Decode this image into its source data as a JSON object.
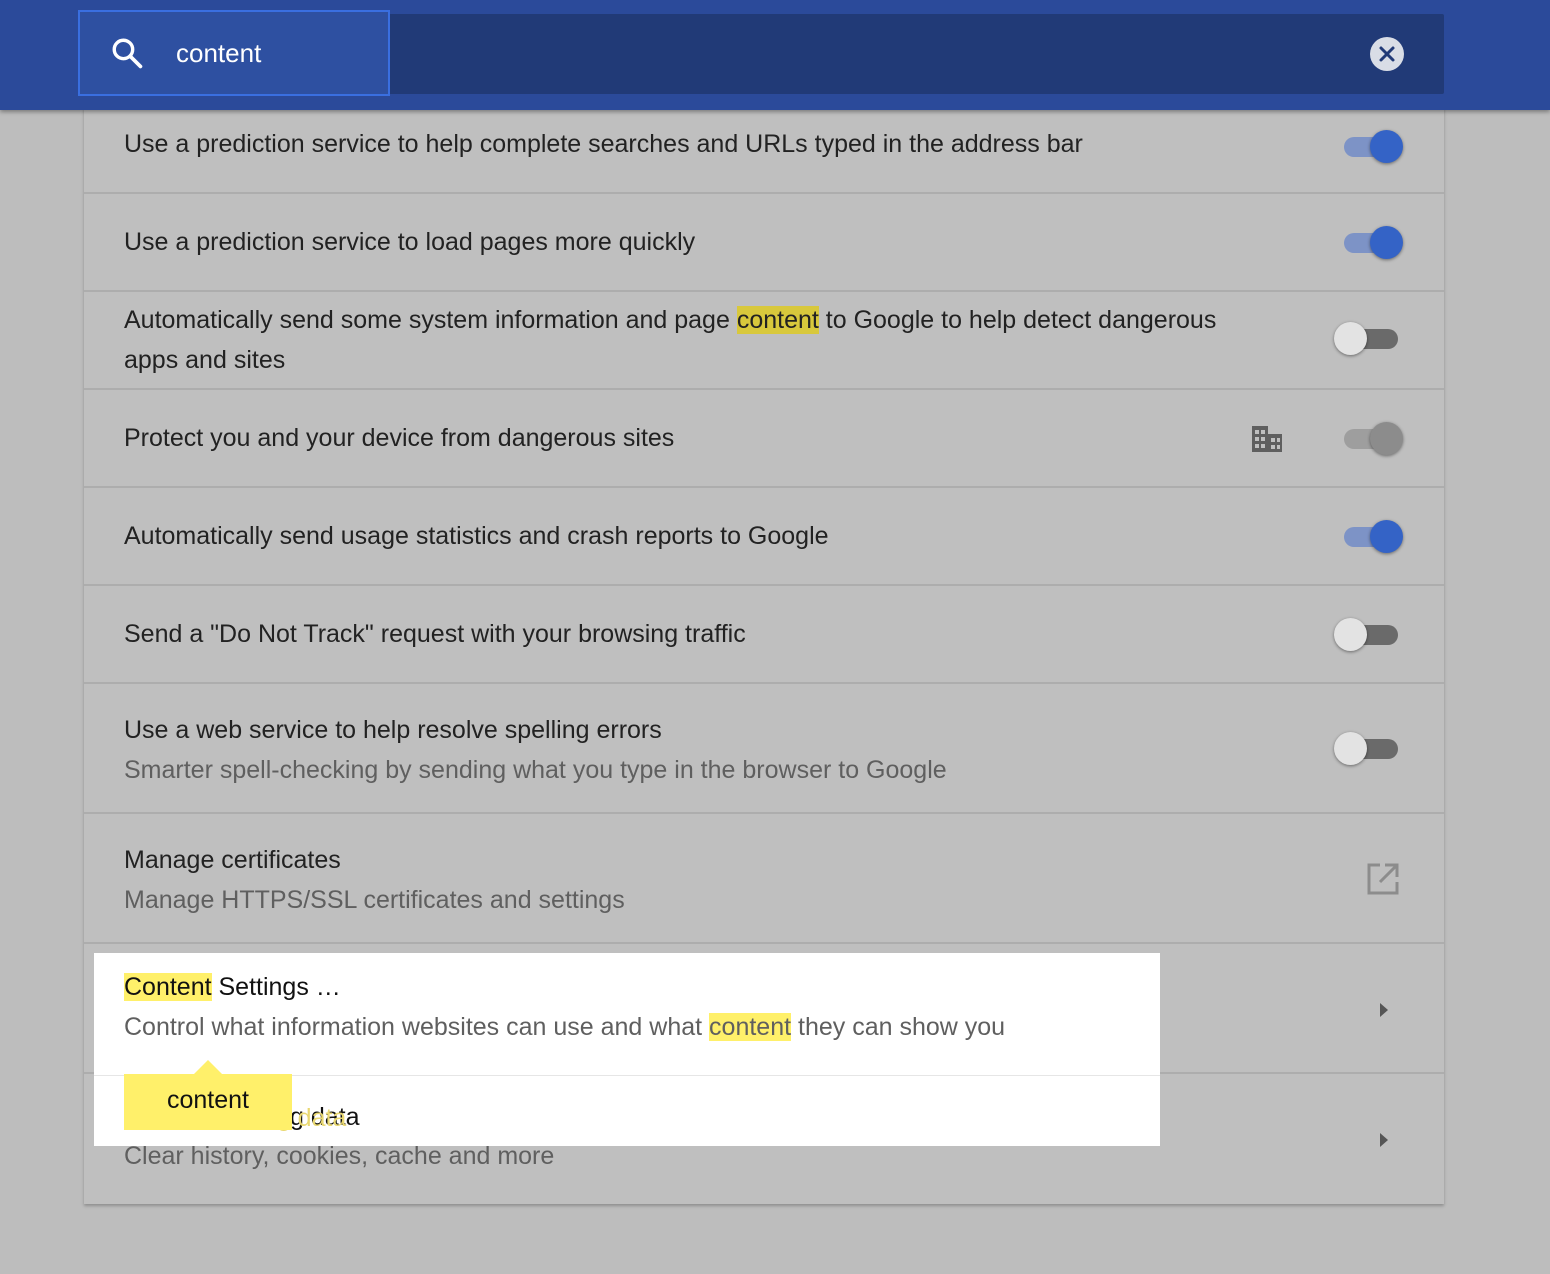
{
  "search": {
    "value": "content"
  },
  "rows": [
    {
      "label": "Use a prediction service to help complete searches and URLs typed in the address bar",
      "toggle": "on"
    },
    {
      "label": "Use a prediction service to load pages more quickly",
      "toggle": "on"
    },
    {
      "label_before": "Automatically send some system information and page ",
      "label_highlight": "content",
      "label_after": " to Google to help detect dangerous",
      "label_line2": "apps and sites",
      "toggle": "off"
    },
    {
      "label": "Protect you and your device from dangerous sites",
      "toggle": "disabled",
      "icon": "enterprise-building-icon"
    },
    {
      "label": "Automatically send usage statistics and crash reports to Google",
      "toggle": "on"
    },
    {
      "label": "Send a \"Do Not Track\" request with your browsing traffic",
      "toggle": "off"
    },
    {
      "label": "Use a web service to help resolve spelling errors",
      "sub": "Smarter spell-checking by sending what you type in the browser to Google",
      "toggle": "off"
    },
    {
      "label": "Manage certificates",
      "sub": "Manage HTTPS/SSL certificates and settings",
      "icon": "open-external-icon"
    },
    {
      "label_highlight": "Content",
      "label_after": " Settings …",
      "sub_before": "Control what information websites can use and what ",
      "sub_highlight": "content",
      "sub_after": " they can show you",
      "icon": "chevron-right-icon"
    },
    {
      "label": "Clear browsing data",
      "label_visible_after_bubble": "g data",
      "sub": "Clear history, cookies, cache and more",
      "icon": "chevron-right-icon"
    }
  ],
  "bubble": {
    "text": "content"
  },
  "colors": {
    "topbar": "#2b4a9a",
    "toggle_on": "#3463c6",
    "highlight_match": "#fff06a"
  }
}
